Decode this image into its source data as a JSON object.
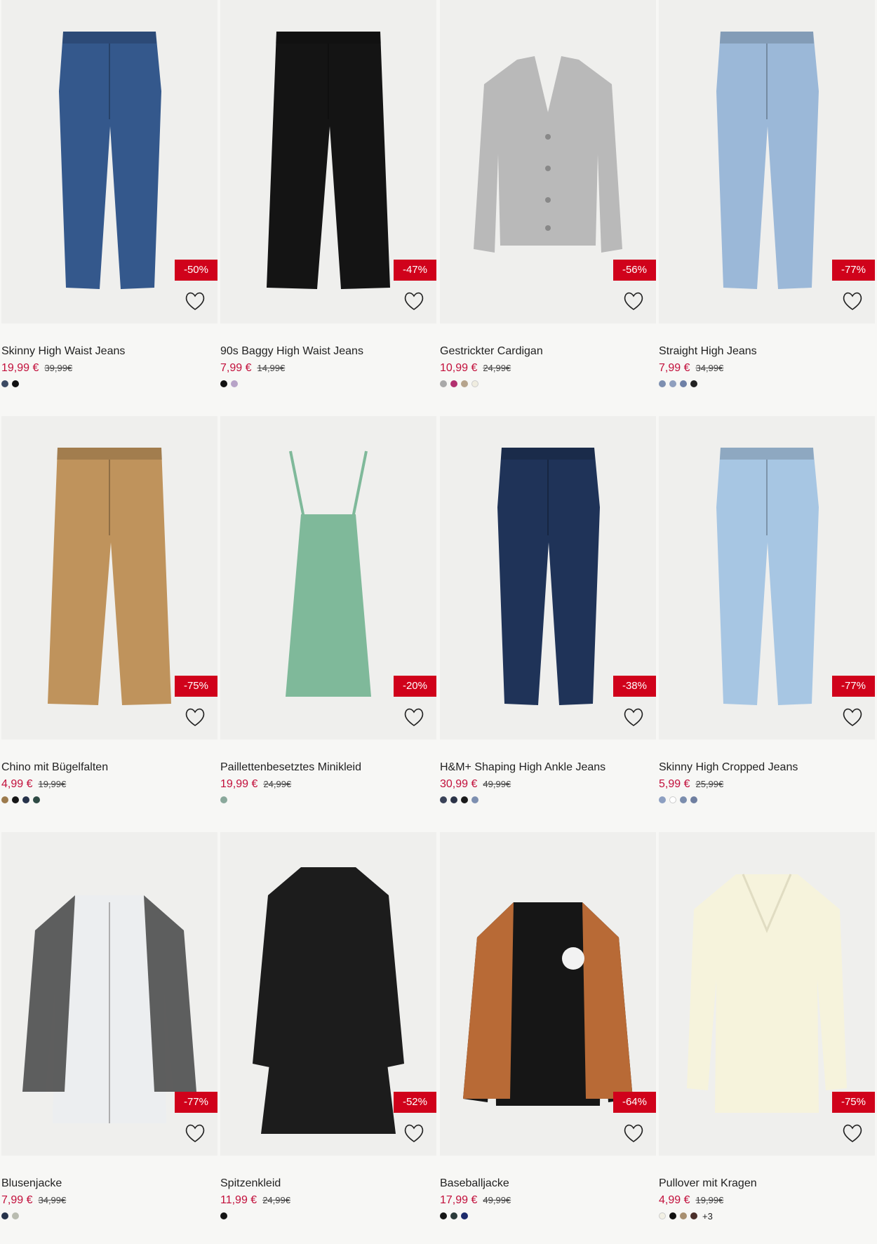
{
  "products": [
    {
      "name": "Skinny High Waist Jeans",
      "price": "19,99 €",
      "old_price": "39,99€",
      "discount": "-50%",
      "swatches": [
        "#3b4a63",
        "#111111"
      ],
      "more": "",
      "shape": "jeans",
      "color": "#34588c"
    },
    {
      "name": "90s Baggy High Waist Jeans",
      "price": "7,99 €",
      "old_price": "14,99€",
      "discount": "-47%",
      "swatches": [
        "#111111",
        "#b7a3c7"
      ],
      "more": "",
      "shape": "wide",
      "color": "#141414"
    },
    {
      "name": "Gestrickter Cardigan",
      "price": "10,99 €",
      "old_price": "24,99€",
      "discount": "-56%",
      "swatches": [
        "#a9a9a9",
        "#b2306f",
        "#b6a48c",
        "#f0ede0"
      ],
      "more": "",
      "shape": "cardigan",
      "color": "#b9b9b9"
    },
    {
      "name": "Straight High Jeans",
      "price": "7,99 €",
      "old_price": "34,99€",
      "discount": "-77%",
      "swatches": [
        "#7d8fb0",
        "#8f9fbe",
        "#6e80a6",
        "#222222"
      ],
      "more": "",
      "shape": "jeans",
      "color": "#9bb8d8"
    },
    {
      "name": "Chino mit Bügelfalten",
      "price": "4,99 €",
      "old_price": "19,99€",
      "discount": "-75%",
      "swatches": [
        "#9c7a4c",
        "#151515",
        "#26324a",
        "#2e4a44"
      ],
      "more": "",
      "shape": "wide",
      "color": "#bf935c"
    },
    {
      "name": "Paillettenbesetztes Minikleid",
      "price": "19,99 €",
      "old_price": "24,99€",
      "discount": "-20%",
      "swatches": [
        "#8aa89b"
      ],
      "more": "",
      "shape": "minidress",
      "color": "#7fb99a"
    },
    {
      "name": "H&M+ Shaping High Ankle Jeans",
      "price": "30,99 €",
      "old_price": "49,99€",
      "discount": "-38%",
      "swatches": [
        "#3a4258",
        "#2b3347",
        "#1a1a1a",
        "#7d8fb0"
      ],
      "more": "",
      "shape": "jeans",
      "color": "#1f3358"
    },
    {
      "name": "Skinny High Cropped Jeans",
      "price": "5,99 €",
      "old_price": "25,99€",
      "discount": "-77%",
      "swatches": [
        "#8d9fc1",
        "#ffffff",
        "#7b8dad",
        "#6f7fa0"
      ],
      "more": "",
      "shape": "jeans",
      "color": "#a7c6e3"
    },
    {
      "name": "Blusenjacke",
      "price": "7,99 €",
      "old_price": "34,99€",
      "discount": "-77%",
      "swatches": [
        "#26324a",
        "#b9bcb0"
      ],
      "more": "",
      "shape": "shirtjacket",
      "color": "#eceef0"
    },
    {
      "name": "Spitzenkleid",
      "price": "11,99 €",
      "old_price": "24,99€",
      "discount": "-52%",
      "swatches": [
        "#151515"
      ],
      "more": "",
      "shape": "dress",
      "color": "#1c1c1c"
    },
    {
      "name": "Baseballjacke",
      "price": "17,99 €",
      "old_price": "49,99€",
      "discount": "-64%",
      "swatches": [
        "#151515",
        "#2b3a3a",
        "#1c2a6b"
      ],
      "more": "",
      "shape": "baseball",
      "color": "#161616"
    },
    {
      "name": "Pullover mit Kragen",
      "price": "4,99 €",
      "old_price": "19,99€",
      "discount": "-75%",
      "swatches": [
        "#f2f0e4",
        "#111111",
        "#a88f70",
        "#4a2f2a"
      ],
      "more": "+3",
      "shape": "sweater",
      "color": "#f6f3dc"
    }
  ]
}
